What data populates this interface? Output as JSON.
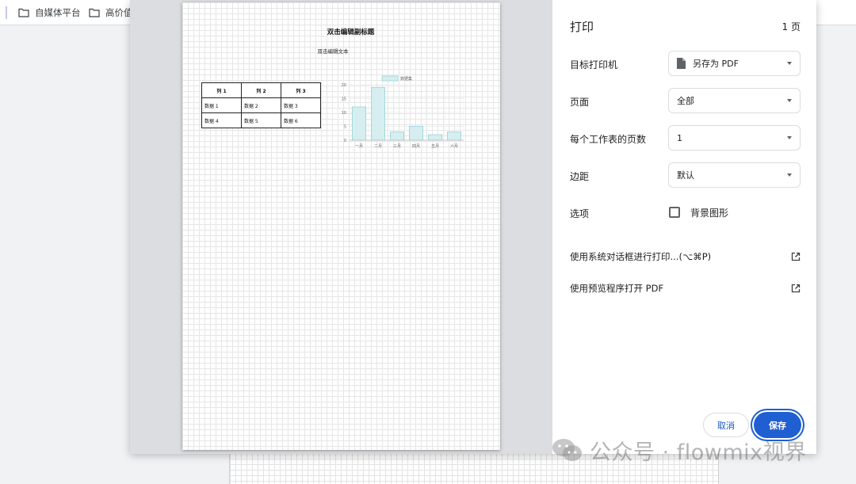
{
  "bookmarks": [
    {
      "label": "自媒体平台",
      "icon": "folder-icon"
    },
    {
      "label": "高价值",
      "icon": "folder-icon"
    }
  ],
  "document": {
    "title": "双击编辑副标题",
    "text": "双击编辑文本",
    "table": {
      "headers": [
        "列 1",
        "列 2",
        "列 3"
      ],
      "rows": [
        [
          "数据 1",
          "数据 2",
          "数据 3"
        ],
        [
          "数据 4",
          "数据 5",
          "数据 6"
        ]
      ]
    }
  },
  "chart_data": {
    "type": "bar",
    "categories": [
      "一月",
      "二月",
      "三月",
      "四月",
      "五月",
      "六月"
    ],
    "series": [
      {
        "name": "数据集",
        "values": [
          12,
          19,
          3,
          5,
          2,
          3
        ]
      }
    ],
    "ylim": [
      0,
      20
    ],
    "yticks": [
      0,
      5,
      10,
      15,
      20
    ],
    "legend": "top-center",
    "grid": true,
    "bar_fill": "#d6eef0",
    "bar_stroke": "#8ccfd2"
  },
  "panel": {
    "title": "打印",
    "page_count": "1 页",
    "rows": [
      {
        "label": "目标打印机",
        "value": "另存为 PDF",
        "icon": "file-icon"
      },
      {
        "label": "页面",
        "value": "全部"
      },
      {
        "label": "每个工作表的页数",
        "value": "1"
      },
      {
        "label": "边距",
        "value": "默认"
      }
    ],
    "options_label": "选项",
    "background_graphics_label": "背景图形",
    "system_dialog_label": "使用系统对话框进行打印...(⌥⌘P)",
    "open_preview_label": "使用预览程序打开 PDF",
    "cancel_label": "取消",
    "save_label": "保存"
  },
  "watermark": {
    "text": "公众号 · flowmix视界"
  },
  "colors": {
    "accent": "#1f5fd1",
    "link": "#1a56c7"
  }
}
